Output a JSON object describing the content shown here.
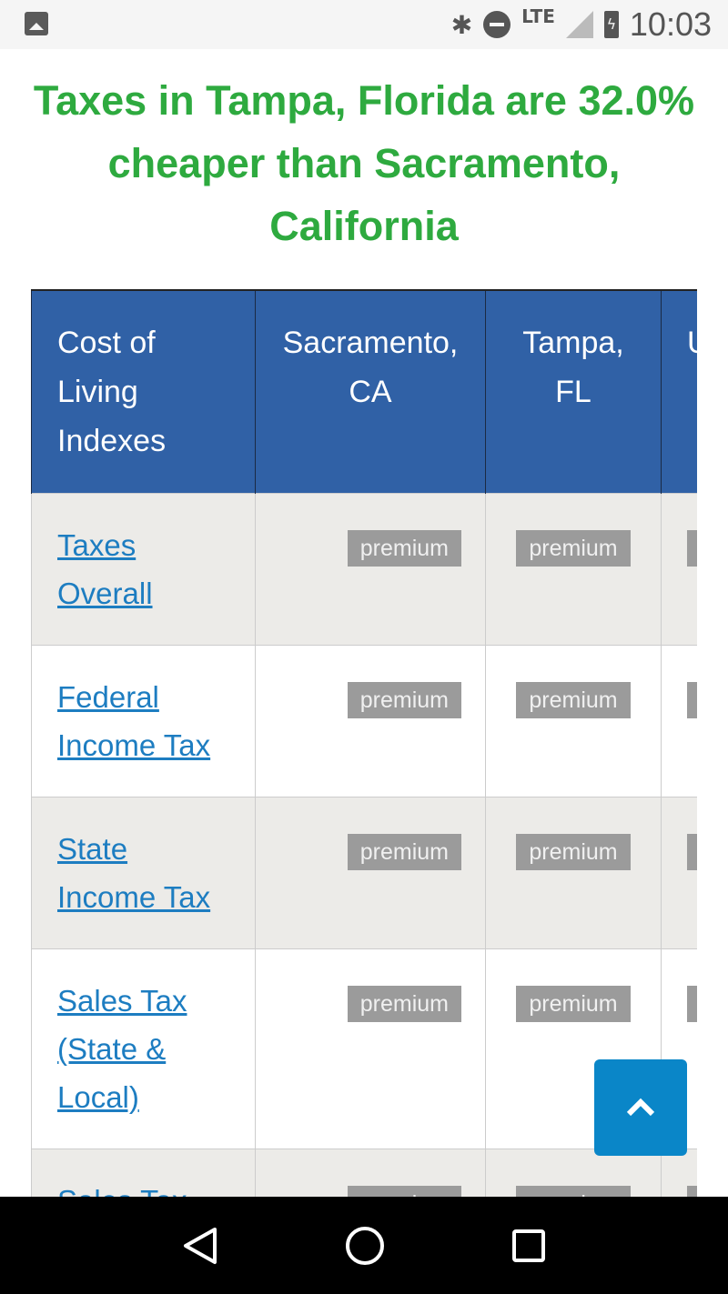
{
  "status_bar": {
    "time": "10:03",
    "network": "LTE"
  },
  "headline": "Taxes in Tampa, Florida are 32.0% cheaper than Sacramento, California",
  "table": {
    "headers": [
      "Cost of Living Indexes",
      "Sacramento, CA",
      "Tampa, FL",
      "U"
    ],
    "rows": [
      {
        "label": "Taxes Overall",
        "values": [
          "premium",
          "premium",
          "premium"
        ]
      },
      {
        "label": "Federal Income Tax",
        "values": [
          "premium",
          "premium",
          "premium"
        ]
      },
      {
        "label": "State Income Tax",
        "values": [
          "premium",
          "premium",
          "premium"
        ]
      },
      {
        "label": "Sales Tax (State & Local)",
        "values": [
          "premium",
          "premium",
          "premium"
        ]
      },
      {
        "label": "Sales Tax",
        "values": [
          "premium",
          "premium",
          "premium"
        ]
      }
    ]
  },
  "colors": {
    "headline": "#2eaa3f",
    "header_bg": "#3061a6",
    "link": "#1d7dc1",
    "fab": "#0a86c8"
  },
  "icons": {
    "fab": "chevron-up-icon"
  }
}
